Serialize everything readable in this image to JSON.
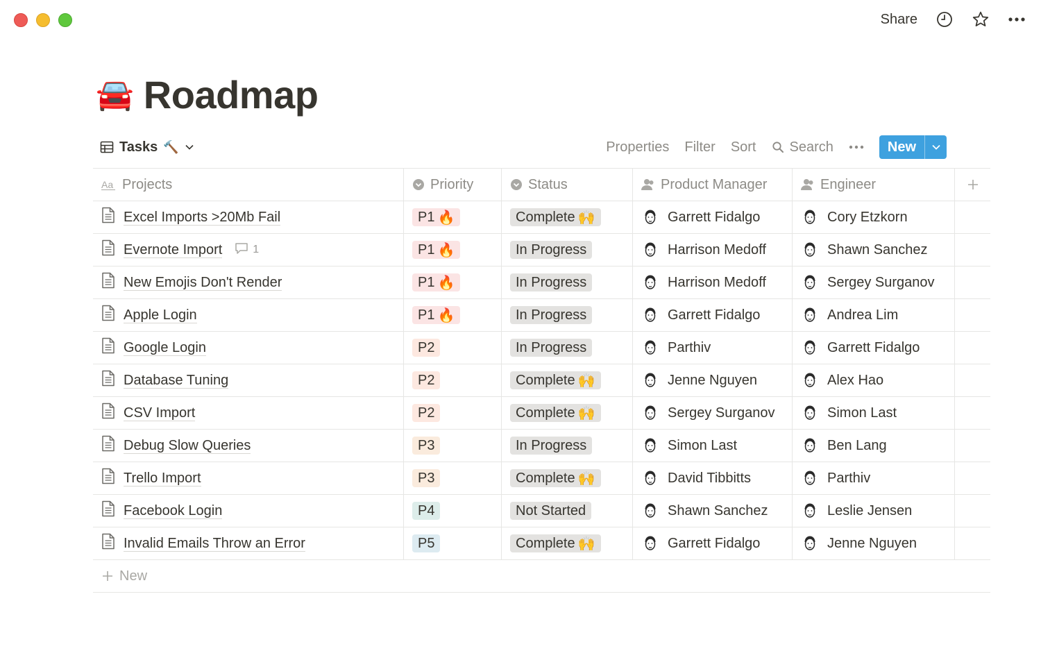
{
  "topbar": {
    "share": "Share"
  },
  "page": {
    "emoji": "🚘",
    "title": "Roadmap"
  },
  "view": {
    "name": "Tasks",
    "emoji": "🔨",
    "properties": "Properties",
    "filter": "Filter",
    "sort": "Sort",
    "search": "Search",
    "new": "New"
  },
  "columns": {
    "projects": "Projects",
    "priority": "Priority",
    "status": "Status",
    "pm": "Product Manager",
    "engineer": "Engineer"
  },
  "rows": [
    {
      "name": "Excel Imports >20Mb Fail",
      "comments": "",
      "priority": "P1",
      "priority_emoji": "🔥",
      "status": "Complete",
      "status_emoji": "🙌",
      "pm": "Garrett Fidalgo",
      "engineer": "Cory Etzkorn"
    },
    {
      "name": "Evernote Import",
      "comments": "1",
      "priority": "P1",
      "priority_emoji": "🔥",
      "status": "In Progress",
      "status_emoji": "",
      "pm": "Harrison Medoff",
      "engineer": "Shawn Sanchez"
    },
    {
      "name": "New Emojis Don't Render",
      "comments": "",
      "priority": "P1",
      "priority_emoji": "🔥",
      "status": "In Progress",
      "status_emoji": "",
      "pm": "Harrison Medoff",
      "engineer": "Sergey Surganov"
    },
    {
      "name": "Apple Login",
      "comments": "",
      "priority": "P1",
      "priority_emoji": "🔥",
      "status": "In Progress",
      "status_emoji": "",
      "pm": "Garrett Fidalgo",
      "engineer": "Andrea Lim"
    },
    {
      "name": "Google Login",
      "comments": "",
      "priority": "P2",
      "priority_emoji": "",
      "status": "In Progress",
      "status_emoji": "",
      "pm": "Parthiv",
      "engineer": "Garrett Fidalgo"
    },
    {
      "name": "Database Tuning",
      "comments": "",
      "priority": "P2",
      "priority_emoji": "",
      "status": "Complete",
      "status_emoji": "🙌",
      "pm": "Jenne Nguyen",
      "engineer": "Alex Hao"
    },
    {
      "name": "CSV Import",
      "comments": "",
      "priority": "P2",
      "priority_emoji": "",
      "status": "Complete",
      "status_emoji": "🙌",
      "pm": "Sergey Surganov",
      "engineer": "Simon Last"
    },
    {
      "name": "Debug Slow Queries",
      "comments": "",
      "priority": "P3",
      "priority_emoji": "",
      "status": "In Progress",
      "status_emoji": "",
      "pm": "Simon Last",
      "engineer": "Ben Lang"
    },
    {
      "name": "Trello Import",
      "comments": "",
      "priority": "P3",
      "priority_emoji": "",
      "status": "Complete",
      "status_emoji": "🙌",
      "pm": "David Tibbitts",
      "engineer": "Parthiv"
    },
    {
      "name": "Facebook Login",
      "comments": "",
      "priority": "P4",
      "priority_emoji": "",
      "status": "Not Started",
      "status_emoji": "",
      "pm": "Shawn Sanchez",
      "engineer": "Leslie Jensen"
    },
    {
      "name": "Invalid Emails Throw an Error",
      "comments": "",
      "priority": "P5",
      "priority_emoji": "",
      "status": "Complete",
      "status_emoji": "🙌",
      "pm": "Garrett Fidalgo",
      "engineer": "Jenne Nguyen"
    }
  ],
  "new_row": "New",
  "colors": {
    "accent": "#3ea1df",
    "P1": "#fbe4e4",
    "P2": "#fde8e0",
    "P3": "#faebdd",
    "P4": "#ddedea",
    "P5": "#ddebf1",
    "status_bg": "#e3e2e0"
  }
}
